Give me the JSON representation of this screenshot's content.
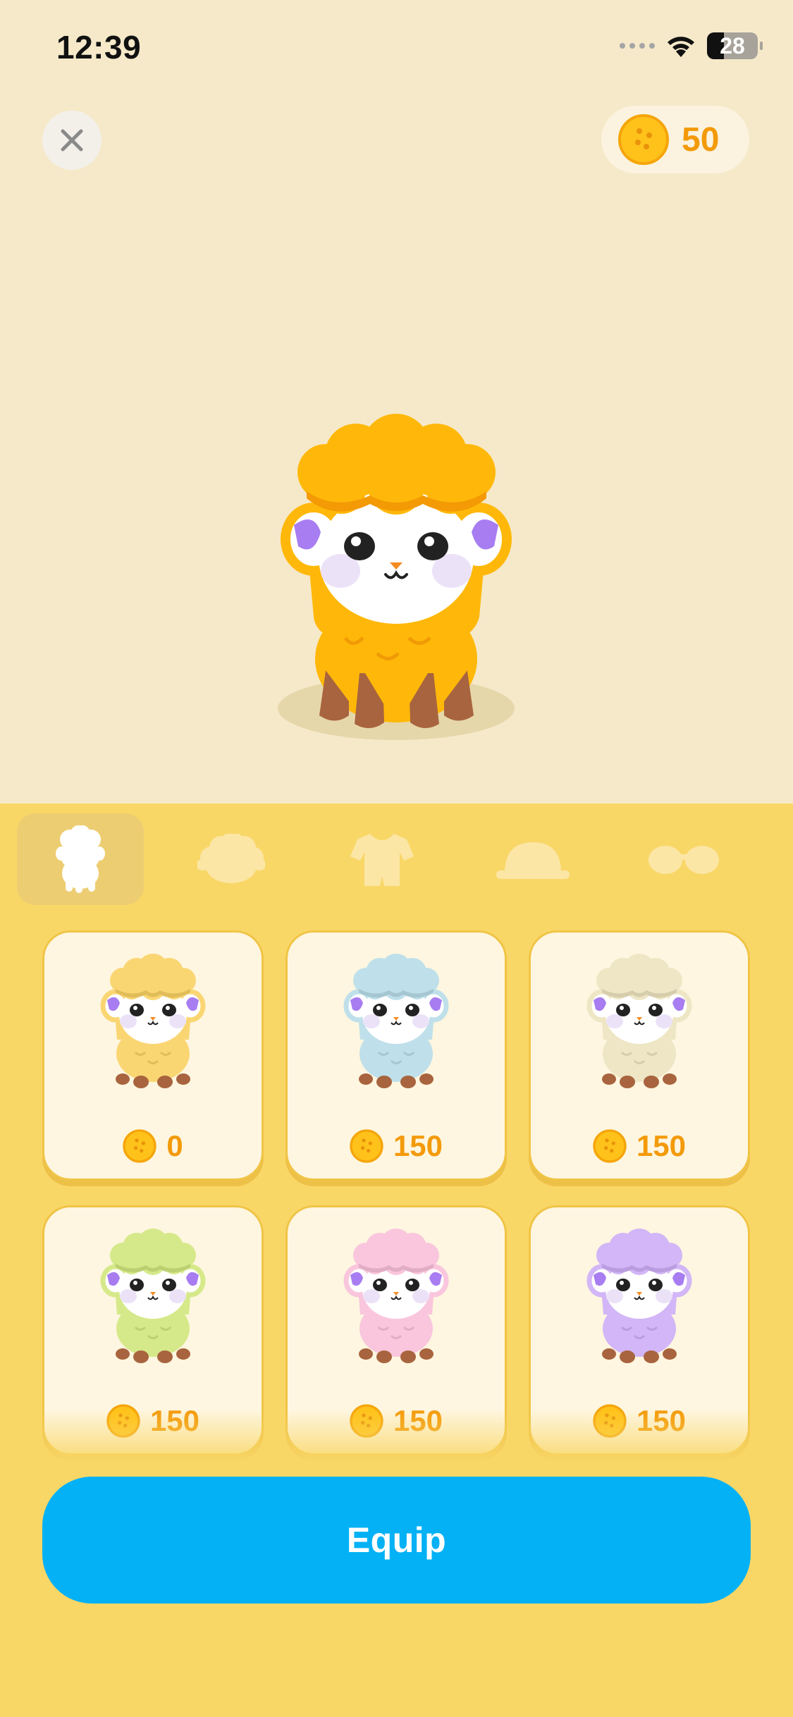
{
  "status_bar": {
    "time": "12:39",
    "battery": "28"
  },
  "header": {
    "close_icon": "close-icon",
    "coins": "50"
  },
  "tabs": [
    {
      "name": "body",
      "icon": "sheep-body-icon",
      "active": true
    },
    {
      "name": "wool",
      "icon": "wool-icon",
      "active": false
    },
    {
      "name": "outfit",
      "icon": "onesie-icon",
      "active": false
    },
    {
      "name": "hat",
      "icon": "hat-icon",
      "active": false
    },
    {
      "name": "glasses",
      "icon": "glasses-icon",
      "active": false
    }
  ],
  "items": [
    {
      "color": "#FAD673",
      "price": "0"
    },
    {
      "color": "#BFE0EA",
      "price": "150"
    },
    {
      "color": "#EEE6C4",
      "price": "150"
    },
    {
      "color": "#D6E98A",
      "price": "150"
    },
    {
      "color": "#F9C6DD",
      "price": "150"
    },
    {
      "color": "#D2B6F7",
      "price": "150"
    }
  ],
  "equip_button": {
    "label": "Equip"
  },
  "colors": {
    "accent_blue": "#04B1F5",
    "coin_orange": "#F39A0B",
    "sheep_main": "#FFB809"
  }
}
